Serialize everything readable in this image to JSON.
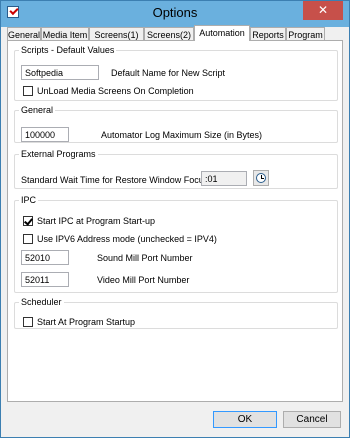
{
  "window": {
    "title": "Options",
    "close_glyph": "✕"
  },
  "tabs": [
    {
      "label": "General"
    },
    {
      "label": "Media Item"
    },
    {
      "label": "Screens(1)"
    },
    {
      "label": "Screens(2)"
    },
    {
      "label": "Automation",
      "active": true
    },
    {
      "label": "Reports"
    },
    {
      "label": "Program"
    }
  ],
  "scripts": {
    "legend": "Scripts - Default Values",
    "script_name_value": "Softpedia",
    "script_name_label": "Default Name for New Script",
    "unload_label": "UnLoad Media Screens On Completion",
    "unload_checked": false
  },
  "general": {
    "legend": "General",
    "log_size_value": "100000",
    "log_size_label": "Automator Log Maximum Size (in Bytes)"
  },
  "external": {
    "legend": "External Programs",
    "wait_label": "Standard Wait Time for Restore Window Focus",
    "wait_value": ":01"
  },
  "ipc": {
    "legend": "IPC",
    "start_ipc_label": "Start IPC at Program Start-up",
    "start_ipc_checked": true,
    "ipv6_label": "Use IPV6 Address mode (unchecked = IPV4)",
    "ipv6_checked": false,
    "sound_port_value": "52010",
    "sound_port_label": "Sound Mill Port Number",
    "video_port_value": "52011",
    "video_port_label": "Video Mill Port Number"
  },
  "scheduler": {
    "legend": "Scheduler",
    "start_label": "Start At Program Startup",
    "start_checked": false
  },
  "footer": {
    "ok_label": "OK",
    "cancel_label": "Cancel"
  }
}
